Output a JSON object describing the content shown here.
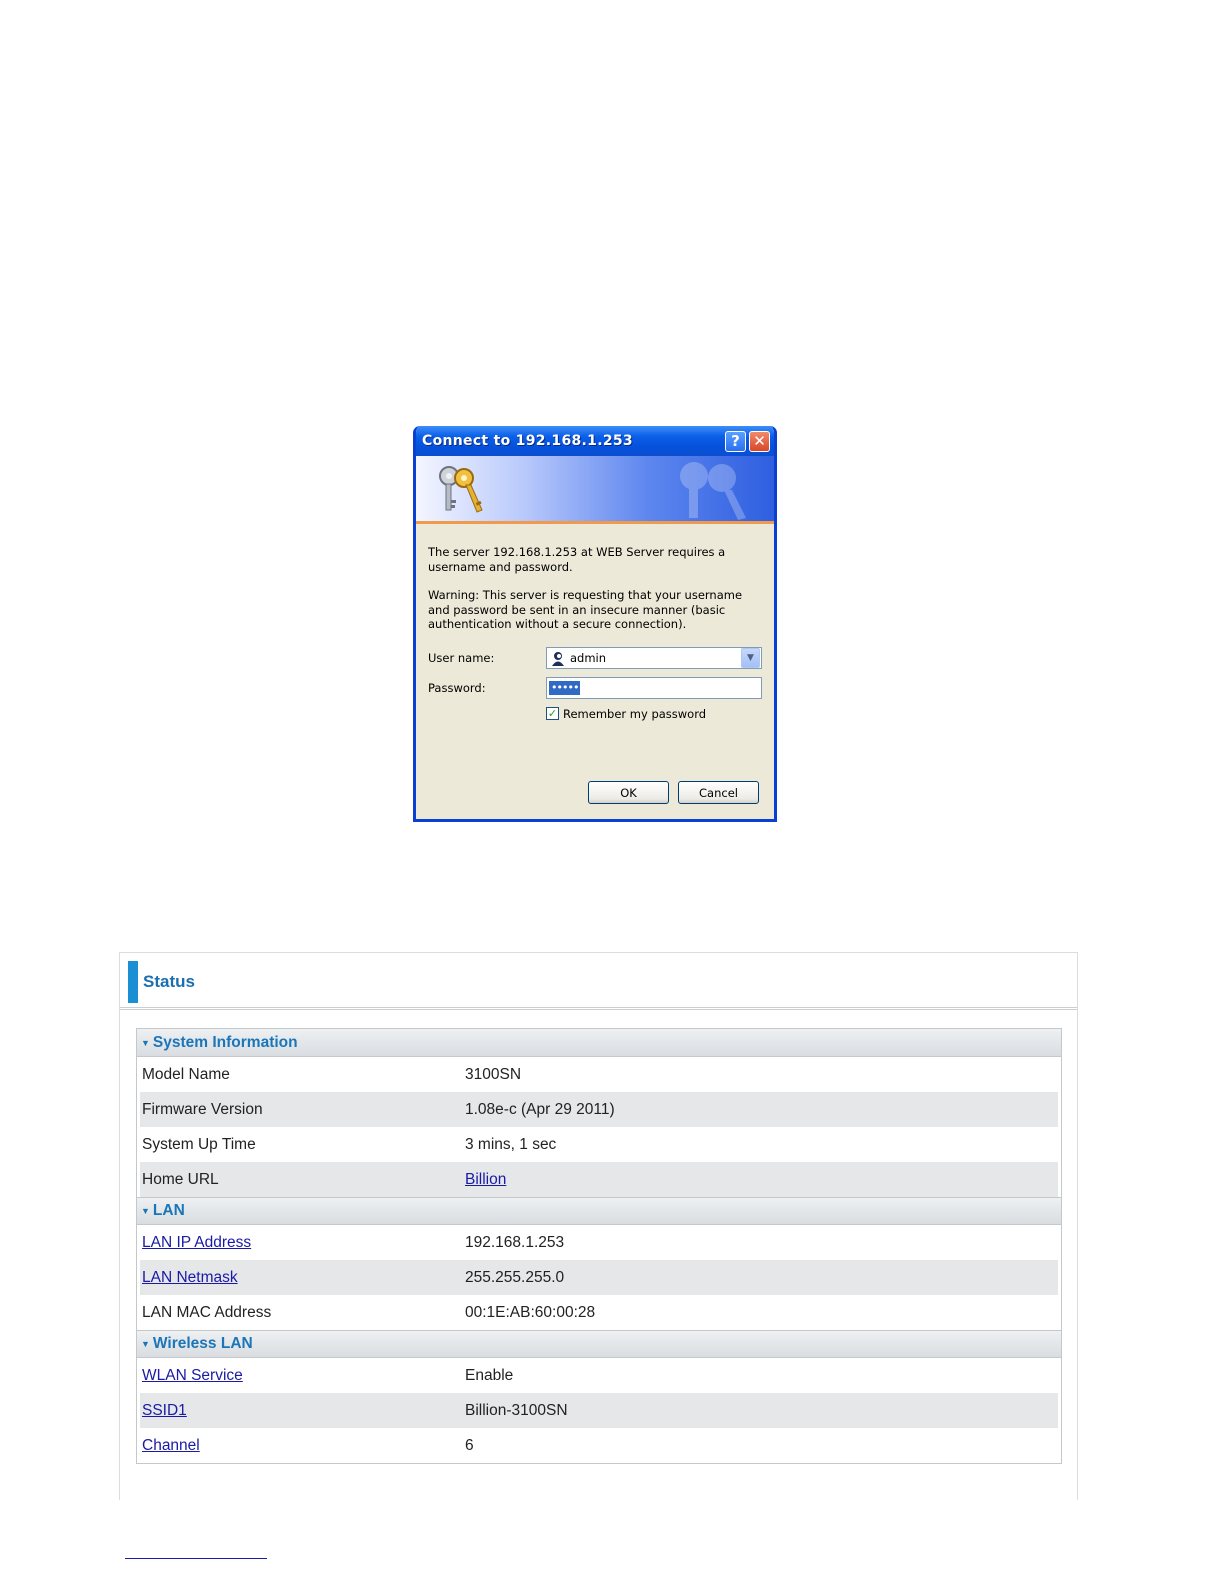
{
  "dialog": {
    "title": "Connect to 192.168.1.253",
    "help_glyph": "?",
    "close_glyph": "✕",
    "message": "The server 192.168.1.253 at WEB Server requires a username and password.",
    "warning": "Warning: This server is requesting that your username and password be sent in an insecure manner (basic authentication without a secure connection).",
    "username_label": "User name:",
    "username_value": "admin",
    "password_label": "Password:",
    "password_value": "•••••",
    "remember_label": "Remember my password",
    "remember_checked": true,
    "ok_label": "OK",
    "cancel_label": "Cancel",
    "icons": [
      "keys-icon",
      "user-icon",
      "chevron-down-icon",
      "help-icon",
      "close-icon",
      "checkmark-icon"
    ],
    "colors": {
      "titlebar": "#0651dc",
      "body": "#ece9d8",
      "accent_stripe": "#f09a4e"
    }
  },
  "status": {
    "title": "Status",
    "sections": [
      {
        "header": "System Information",
        "rows": [
          {
            "key": "Model Name",
            "value": "3100SN"
          },
          {
            "key": "Firmware Version",
            "value": "1.08e-c (Apr 29 2011)"
          },
          {
            "key": "System Up Time",
            "value": "3 mins, 1 sec"
          },
          {
            "key": "Home URL",
            "value": "Billion"
          }
        ]
      },
      {
        "header": "LAN",
        "rows": [
          {
            "key": "LAN IP Address",
            "value": "192.168.1.253"
          },
          {
            "key": "LAN Netmask",
            "value": "255.255.255.0"
          },
          {
            "key": "LAN MAC Address",
            "value": "00:1E:AB:60:00:28"
          }
        ]
      },
      {
        "header": "Wireless LAN",
        "rows": [
          {
            "key": "WLAN Service",
            "value": "Enable"
          },
          {
            "key": "SSID1",
            "value": "Billion-3100SN"
          },
          {
            "key": "Channel",
            "value": "6"
          }
        ]
      }
    ],
    "colors": {
      "accent": "#1b8fd4",
      "section_text": "#1a76b8",
      "link": "#1a1aa6",
      "alt_row": "#e5e7e9"
    }
  }
}
